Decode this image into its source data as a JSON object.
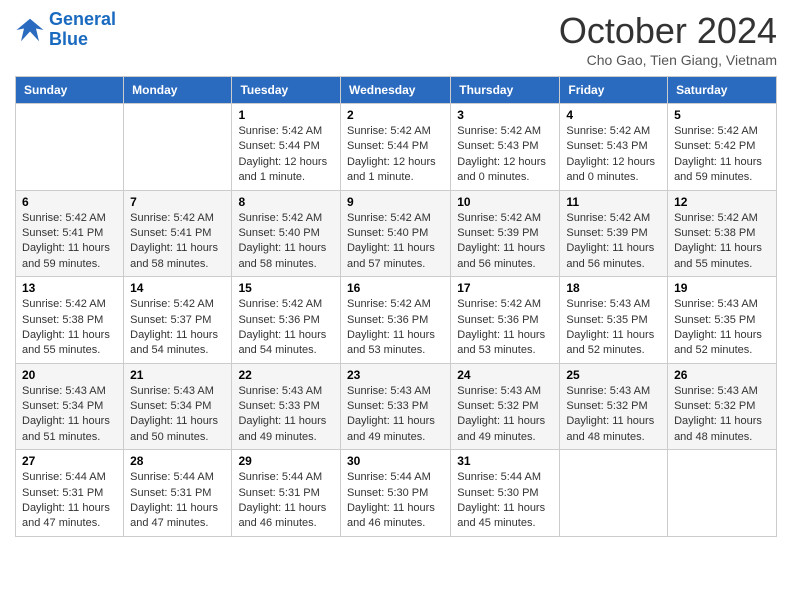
{
  "logo": {
    "line1": "General",
    "line2": "Blue"
  },
  "title": "October 2024",
  "location": "Cho Gao, Tien Giang, Vietnam",
  "days_of_week": [
    "Sunday",
    "Monday",
    "Tuesday",
    "Wednesday",
    "Thursday",
    "Friday",
    "Saturday"
  ],
  "weeks": [
    [
      {
        "day": "",
        "info": ""
      },
      {
        "day": "",
        "info": ""
      },
      {
        "day": "1",
        "info": "Sunrise: 5:42 AM\nSunset: 5:44 PM\nDaylight: 12 hours\nand 1 minute."
      },
      {
        "day": "2",
        "info": "Sunrise: 5:42 AM\nSunset: 5:44 PM\nDaylight: 12 hours\nand 1 minute."
      },
      {
        "day": "3",
        "info": "Sunrise: 5:42 AM\nSunset: 5:43 PM\nDaylight: 12 hours\nand 0 minutes."
      },
      {
        "day": "4",
        "info": "Sunrise: 5:42 AM\nSunset: 5:43 PM\nDaylight: 12 hours\nand 0 minutes."
      },
      {
        "day": "5",
        "info": "Sunrise: 5:42 AM\nSunset: 5:42 PM\nDaylight: 11 hours\nand 59 minutes."
      }
    ],
    [
      {
        "day": "6",
        "info": "Sunrise: 5:42 AM\nSunset: 5:41 PM\nDaylight: 11 hours\nand 59 minutes."
      },
      {
        "day": "7",
        "info": "Sunrise: 5:42 AM\nSunset: 5:41 PM\nDaylight: 11 hours\nand 58 minutes."
      },
      {
        "day": "8",
        "info": "Sunrise: 5:42 AM\nSunset: 5:40 PM\nDaylight: 11 hours\nand 58 minutes."
      },
      {
        "day": "9",
        "info": "Sunrise: 5:42 AM\nSunset: 5:40 PM\nDaylight: 11 hours\nand 57 minutes."
      },
      {
        "day": "10",
        "info": "Sunrise: 5:42 AM\nSunset: 5:39 PM\nDaylight: 11 hours\nand 56 minutes."
      },
      {
        "day": "11",
        "info": "Sunrise: 5:42 AM\nSunset: 5:39 PM\nDaylight: 11 hours\nand 56 minutes."
      },
      {
        "day": "12",
        "info": "Sunrise: 5:42 AM\nSunset: 5:38 PM\nDaylight: 11 hours\nand 55 minutes."
      }
    ],
    [
      {
        "day": "13",
        "info": "Sunrise: 5:42 AM\nSunset: 5:38 PM\nDaylight: 11 hours\nand 55 minutes."
      },
      {
        "day": "14",
        "info": "Sunrise: 5:42 AM\nSunset: 5:37 PM\nDaylight: 11 hours\nand 54 minutes."
      },
      {
        "day": "15",
        "info": "Sunrise: 5:42 AM\nSunset: 5:36 PM\nDaylight: 11 hours\nand 54 minutes."
      },
      {
        "day": "16",
        "info": "Sunrise: 5:42 AM\nSunset: 5:36 PM\nDaylight: 11 hours\nand 53 minutes."
      },
      {
        "day": "17",
        "info": "Sunrise: 5:42 AM\nSunset: 5:36 PM\nDaylight: 11 hours\nand 53 minutes."
      },
      {
        "day": "18",
        "info": "Sunrise: 5:43 AM\nSunset: 5:35 PM\nDaylight: 11 hours\nand 52 minutes."
      },
      {
        "day": "19",
        "info": "Sunrise: 5:43 AM\nSunset: 5:35 PM\nDaylight: 11 hours\nand 52 minutes."
      }
    ],
    [
      {
        "day": "20",
        "info": "Sunrise: 5:43 AM\nSunset: 5:34 PM\nDaylight: 11 hours\nand 51 minutes."
      },
      {
        "day": "21",
        "info": "Sunrise: 5:43 AM\nSunset: 5:34 PM\nDaylight: 11 hours\nand 50 minutes."
      },
      {
        "day": "22",
        "info": "Sunrise: 5:43 AM\nSunset: 5:33 PM\nDaylight: 11 hours\nand 49 minutes."
      },
      {
        "day": "23",
        "info": "Sunrise: 5:43 AM\nSunset: 5:33 PM\nDaylight: 11 hours\nand 49 minutes."
      },
      {
        "day": "24",
        "info": "Sunrise: 5:43 AM\nSunset: 5:32 PM\nDaylight: 11 hours\nand 49 minutes."
      },
      {
        "day": "25",
        "info": "Sunrise: 5:43 AM\nSunset: 5:32 PM\nDaylight: 11 hours\nand 48 minutes."
      },
      {
        "day": "26",
        "info": "Sunrise: 5:43 AM\nSunset: 5:32 PM\nDaylight: 11 hours\nand 48 minutes."
      }
    ],
    [
      {
        "day": "27",
        "info": "Sunrise: 5:44 AM\nSunset: 5:31 PM\nDaylight: 11 hours\nand 47 minutes."
      },
      {
        "day": "28",
        "info": "Sunrise: 5:44 AM\nSunset: 5:31 PM\nDaylight: 11 hours\nand 47 minutes."
      },
      {
        "day": "29",
        "info": "Sunrise: 5:44 AM\nSunset: 5:31 PM\nDaylight: 11 hours\nand 46 minutes."
      },
      {
        "day": "30",
        "info": "Sunrise: 5:44 AM\nSunset: 5:30 PM\nDaylight: 11 hours\nand 46 minutes."
      },
      {
        "day": "31",
        "info": "Sunrise: 5:44 AM\nSunset: 5:30 PM\nDaylight: 11 hours\nand 45 minutes."
      },
      {
        "day": "",
        "info": ""
      },
      {
        "day": "",
        "info": ""
      }
    ]
  ]
}
